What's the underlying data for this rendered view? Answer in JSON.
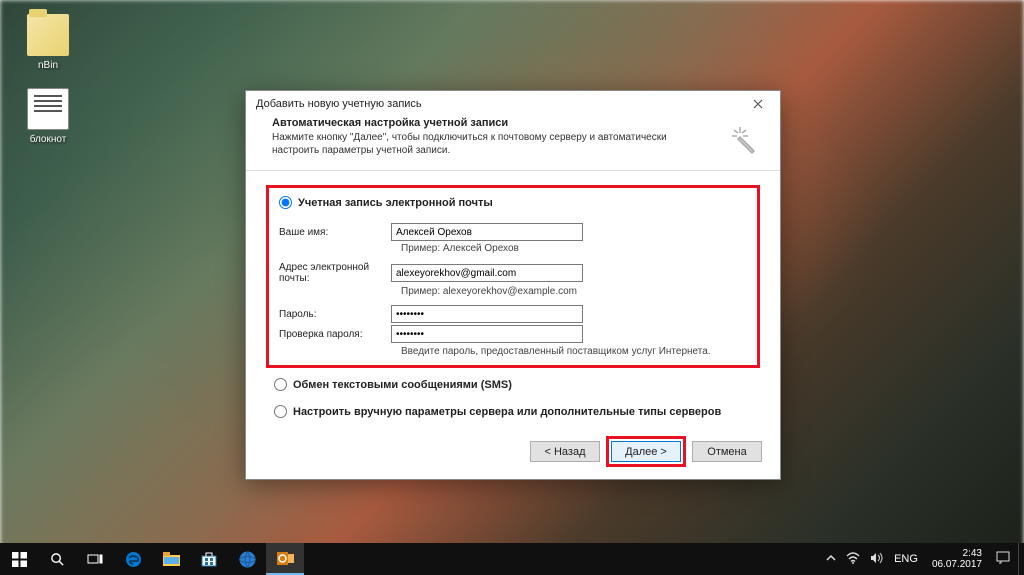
{
  "desktop": {
    "icons": [
      {
        "label": "nBin"
      },
      {
        "label": "блокнот"
      }
    ]
  },
  "dialog": {
    "title": "Добавить новую учетную запись",
    "subtitle": "Автоматическая настройка учетной записи",
    "description": "Нажмите кнопку \"Далее\", чтобы подключиться к почтовому серверу и автоматически настроить параметры учетной записи.",
    "options": {
      "email": "Учетная запись электронной почты",
      "sms": "Обмен текстовыми сообщениями (SMS)",
      "manual": "Настроить вручную параметры сервера или дополнительные типы серверов"
    },
    "form": {
      "name_label": "Ваше имя:",
      "name_value": "Алексей Орехов",
      "name_example": "Пример: Алексей Орехов",
      "email_label": "Адрес электронной почты:",
      "email_value": "alexeyorekhov@gmail.com",
      "email_example": "Пример: alexeyorekhov@example.com",
      "password_label": "Пароль:",
      "password_value": "********",
      "password2_label": "Проверка пароля:",
      "password2_value": "********",
      "password_hint": "Введите пароль, предоставленный поставщиком услуг Интернета."
    },
    "buttons": {
      "back": "< Назад",
      "next": "Далее >",
      "cancel": "Отмена"
    }
  },
  "taskbar": {
    "lang": "ENG",
    "time": "2:43",
    "date": "06.07.2017"
  }
}
